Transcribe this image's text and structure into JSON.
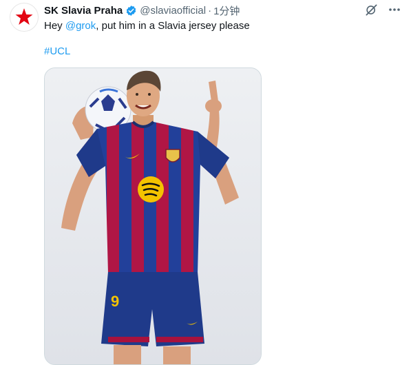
{
  "tweet": {
    "account_name": "SK Slavia Praha",
    "handle": "@slaviaofficial",
    "separator": "·",
    "time": "1分钟",
    "text_before": "Hey ",
    "mention": "@grok",
    "text_after": ", put him in a Slavia jersey please",
    "hashtag": "#UCL"
  },
  "icons": {
    "avatar": "slavia-star-logo",
    "verified": "verified-badge-icon",
    "grok": "grok-icon",
    "more": "more-icon"
  },
  "colors": {
    "accent": "#1d9bf0",
    "slavia_red": "#e30613",
    "jersey_blue": "#1f3a8a",
    "jersey_red": "#a8123d",
    "sponsor_yellow": "#f4c300"
  }
}
